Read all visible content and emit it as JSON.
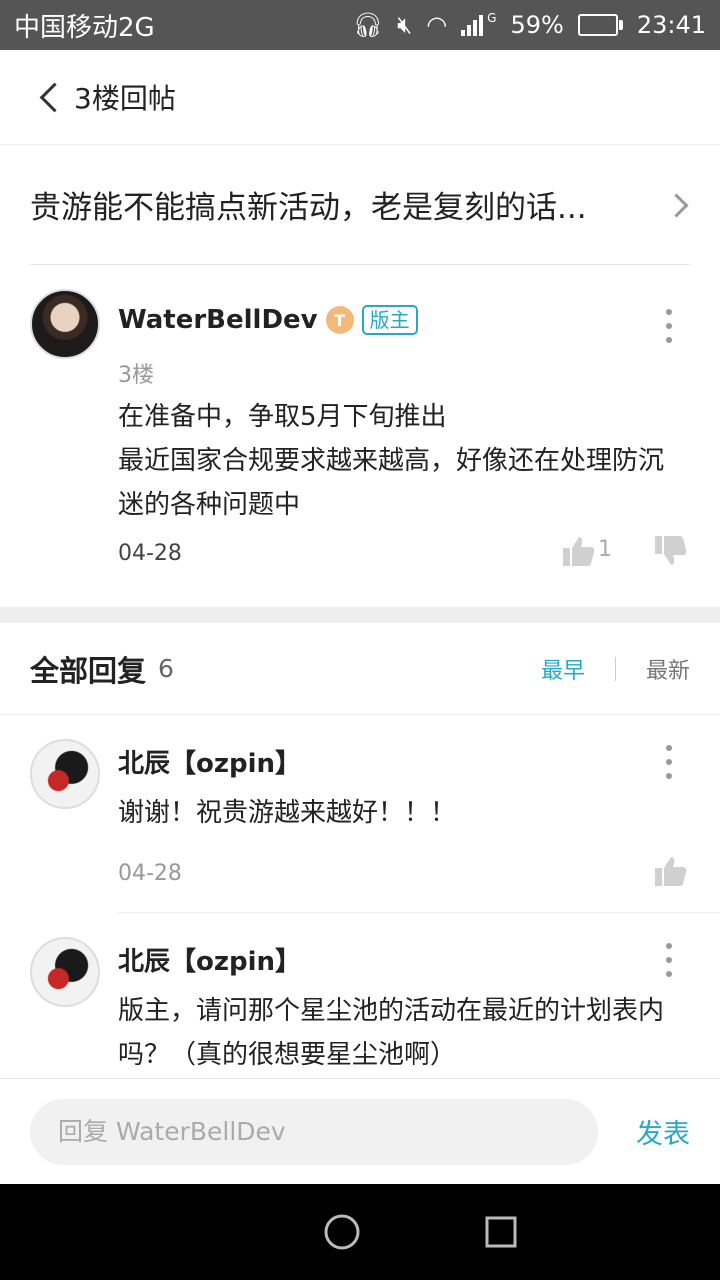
{
  "status_bar": {
    "carrier": "中国移动2G",
    "network_type": "G",
    "battery": "59%",
    "battery_level": 0.59,
    "time": "23:41"
  },
  "nav": {
    "title": "3楼回帖"
  },
  "thread": {
    "title": "贵游能不能搞点新活动，老是复刻的话..."
  },
  "post": {
    "author": "WaterBellDev",
    "level_badge": "T",
    "role_badge": "版主",
    "floor": "3楼",
    "content_lines": [
      "在准备中，争取5月下旬推出",
      "最近国家合规要求越来越高，好像还在处理防沉迷的各种问题中"
    ],
    "date": "04-28",
    "like_count": "1"
  },
  "replies_header": {
    "title": "全部回复",
    "count": "6",
    "sort_earliest": "最早",
    "sort_latest": "最新"
  },
  "replies": [
    {
      "author": "北辰【ozpin】",
      "text": "谢谢！祝贵游越来越好！！！",
      "date": "04-28"
    },
    {
      "author": "北辰【ozpin】",
      "text": "版主，请问那个星尘池的活动在最近的计划表内吗？（真的很想要星尘池啊）",
      "date": ""
    }
  ],
  "input": {
    "placeholder": "回复 WaterBellDev",
    "send_label": "发表"
  },
  "colors": {
    "accent": "#27a9c6",
    "status_bar": "#555555",
    "nav_bar": "#000000"
  }
}
